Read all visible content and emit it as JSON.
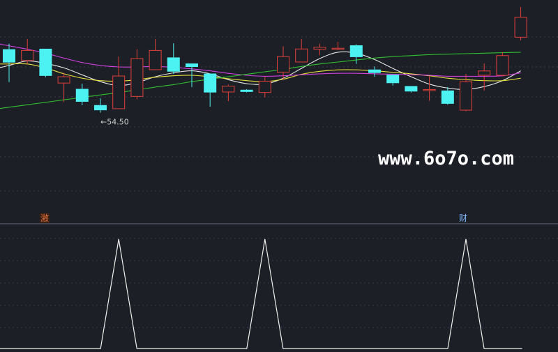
{
  "chart_data": [
    {
      "type": "candlestick",
      "title": "",
      "xlabel": "",
      "ylabel": "",
      "colors": {
        "up": "#e0403a",
        "down": "#4cf2f2",
        "ma_white": "#e8e8e8",
        "ma_yellow": "#e8e040",
        "ma_magenta": "#d040e0",
        "ma_green": "#30c030",
        "background": "#1c1f26"
      },
      "low_marker": {
        "text": "←54.50",
        "value": 54.5
      },
      "ylim": [
        45.5,
        76.0
      ],
      "candles": [
        {
          "o": 67.4,
          "h": 68.53,
          "l": 60.72,
          "c": 64.7
        },
        {
          "o": 65.1,
          "h": 69.5,
          "l": 64.4,
          "c": 67.15
        },
        {
          "o": 67.5,
          "h": 67.5,
          "l": 61.7,
          "c": 61.98
        },
        {
          "o": 60.52,
          "h": 62.61,
          "l": 56.67,
          "c": 61.8
        },
        {
          "o": 59.33,
          "h": 60.4,
          "l": 56.0,
          "c": 56.71
        },
        {
          "o": 56.03,
          "h": 57.4,
          "l": 54.5,
          "c": 54.98
        },
        {
          "o": 55.3,
          "h": 65.95,
          "l": 55.3,
          "c": 61.95
        },
        {
          "o": 57.8,
          "h": 67.38,
          "l": 57.2,
          "c": 65.5
        },
        {
          "o": 63.23,
          "h": 69.5,
          "l": 63.23,
          "c": 67.15
        },
        {
          "o": 65.73,
          "h": 68.6,
          "l": 62.36,
          "c": 62.84
        },
        {
          "o": 64.5,
          "h": 64.5,
          "l": 59.7,
          "c": 63.8
        },
        {
          "o": 62.45,
          "h": 62.45,
          "l": 55.7,
          "c": 58.6
        },
        {
          "o": 58.7,
          "h": 60.2,
          "l": 56.83,
          "c": 59.9
        },
        {
          "o": 59.15,
          "h": 59.3,
          "l": 58.6,
          "c": 58.72
        },
        {
          "o": 58.6,
          "h": 61.75,
          "l": 57.6,
          "c": 60.9
        },
        {
          "o": 62.7,
          "h": 68.0,
          "l": 61.2,
          "c": 65.9
        },
        {
          "o": 64.8,
          "h": 69.5,
          "l": 64.8,
          "c": 67.45
        },
        {
          "o": 67.4,
          "h": 68.53,
          "l": 66.2,
          "c": 67.8
        },
        {
          "o": 67.6,
          "h": 68.9,
          "l": 67.2,
          "c": 67.6
        },
        {
          "o": 68.2,
          "h": 68.4,
          "l": 64.4,
          "c": 65.8
        },
        {
          "o": 63.27,
          "h": 63.9,
          "l": 61.8,
          "c": 62.57
        },
        {
          "o": 62.2,
          "h": 62.2,
          "l": 60.0,
          "c": 60.5
        },
        {
          "o": 59.9,
          "h": 59.9,
          "l": 58.6,
          "c": 58.8
        },
        {
          "o": 59.0,
          "h": 61.9,
          "l": 56.9,
          "c": 59.2
        },
        {
          "o": 59.0,
          "h": 59.7,
          "l": 56.1,
          "c": 56.3
        },
        {
          "o": 55.0,
          "h": 62.4,
          "l": 54.8,
          "c": 60.8
        },
        {
          "o": 62.1,
          "h": 64.5,
          "l": 59.0,
          "c": 62.98
        },
        {
          "o": 62.1,
          "h": 66.8,
          "l": 61.9,
          "c": 66.1
        },
        {
          "o": 69.85,
          "h": 76.0,
          "l": 69.2,
          "c": 73.9
        }
      ],
      "ma_lines": [
        {
          "name": "",
          "color": "#e8e8e8",
          "values": [
            64.1,
            65.0,
            64.5,
            63.6,
            62.2,
            60.8,
            60.0,
            60.6,
            61.8,
            62.6,
            63.0,
            62.4,
            61.2,
            60.4,
            60.3,
            61.5,
            63.5,
            65.5,
            66.8,
            66.6,
            65.3,
            63.5,
            61.8,
            60.3,
            59.5,
            59.2,
            59.8,
            61.0,
            63.0
          ]
        },
        {
          "name": "",
          "color": "#e8e040",
          "values": [
            64.4,
            64.4,
            63.6,
            62.4,
            61.5,
            61.0,
            60.9,
            61.2,
            61.7,
            62.0,
            62.1,
            61.8,
            61.4,
            61.0,
            60.8,
            61.3,
            62.3,
            62.9,
            63.2,
            63.2,
            63.0,
            62.7,
            62.4,
            62.0,
            61.5,
            61.2,
            61.0,
            61.0,
            61.5
          ]
        },
        {
          "name": "",
          "color": "#d040e0",
          "values": [
            68.1,
            67.4,
            66.6,
            65.6,
            64.7,
            64.1,
            63.8,
            63.8,
            63.9,
            63.7,
            63.4,
            63.0,
            62.5,
            62.1,
            61.9,
            62.0,
            62.2,
            62.4,
            62.5,
            62.5,
            62.4,
            62.3,
            62.2,
            62.1,
            61.9,
            61.9,
            61.9,
            62.0,
            62.6
          ]
        },
        {
          "name": "",
          "color": "#30c030",
          "values": [
            55.6,
            56.1,
            56.6,
            57.1,
            57.6,
            58.1,
            58.6,
            59.1,
            59.7,
            60.2,
            60.8,
            61.3,
            61.8,
            62.3,
            62.8,
            63.3,
            63.9,
            64.4,
            64.8,
            65.2,
            65.6,
            65.9,
            66.1,
            66.3,
            66.4,
            66.5,
            66.6,
            66.7,
            66.8
          ]
        }
      ]
    },
    {
      "type": "line",
      "title": "",
      "xlabel": "",
      "ylabel": "",
      "ylim": [
        0,
        1
      ],
      "series": [
        {
          "name": "",
          "color": "#f0f0f0",
          "values": [
            0,
            0,
            0,
            0,
            0,
            0,
            1,
            0,
            0,
            0,
            0,
            0,
            0,
            0,
            1,
            0,
            0,
            0,
            0,
            0,
            0,
            0,
            0,
            0,
            0,
            1,
            0,
            0,
            0
          ]
        }
      ],
      "signal_labels": [
        {
          "text": "激",
          "index": 2
        },
        {
          "text": "财",
          "index": 25
        }
      ]
    }
  ],
  "watermark": "www.6o7o.com"
}
